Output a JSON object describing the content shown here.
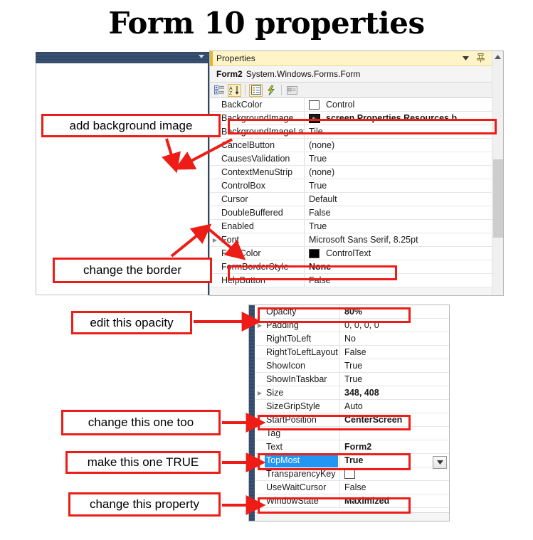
{
  "page": {
    "title": "Form 10 properties"
  },
  "designer": {
    "name": "form-designer-panel",
    "dropdown_icon": "chevron-down-icon"
  },
  "properties_window": {
    "title": "Properties",
    "titlebar_icons": [
      "chevron-down-icon",
      "pin-icon",
      "close-icon"
    ],
    "object_name": "Form2",
    "object_type": "System.Windows.Forms.Form",
    "toolbar": {
      "categorized_label": "Categorized",
      "alphabetical_label": "A↓",
      "properties_label": "Properties",
      "events_label": "Events",
      "property_pages_label": "Property Pages"
    },
    "rows": [
      {
        "name": "BackColor",
        "value": "Control",
        "expander": false,
        "bold": false,
        "swatch": "white"
      },
      {
        "name": "BackgroundImage",
        "value": "screen.Properties.Resources.b",
        "expander": false,
        "bold": true,
        "swatch": "thumb"
      },
      {
        "name": "BackgroundImageLayout",
        "value": "Tile",
        "expander": false,
        "bold": false,
        "swatch": "none"
      },
      {
        "name": "CancelButton",
        "value": "(none)",
        "expander": false,
        "bold": false,
        "swatch": "none"
      },
      {
        "name": "CausesValidation",
        "value": "True",
        "expander": false,
        "bold": false,
        "swatch": "none"
      },
      {
        "name": "ContextMenuStrip",
        "value": "(none)",
        "expander": false,
        "bold": false,
        "swatch": "none"
      },
      {
        "name": "ControlBox",
        "value": "True",
        "expander": false,
        "bold": false,
        "swatch": "none"
      },
      {
        "name": "Cursor",
        "value": "Default",
        "expander": false,
        "bold": false,
        "swatch": "none"
      },
      {
        "name": "DoubleBuffered",
        "value": "False",
        "expander": false,
        "bold": false,
        "swatch": "none"
      },
      {
        "name": "Enabled",
        "value": "True",
        "expander": false,
        "bold": false,
        "swatch": "none"
      },
      {
        "name": "Font",
        "value": "Microsoft Sans Serif, 8.25pt",
        "expander": true,
        "bold": false,
        "swatch": "none"
      },
      {
        "name": "ForeColor",
        "value": "ControlText",
        "expander": false,
        "bold": false,
        "swatch": "black"
      },
      {
        "name": "FormBorderStyle",
        "value": "None",
        "expander": false,
        "bold": true,
        "swatch": "none"
      },
      {
        "name": "HelpButton",
        "value": "False",
        "expander": false,
        "bold": false,
        "swatch": "none"
      }
    ],
    "scrollbar": {
      "up_icon": "chevron-up-icon"
    }
  },
  "properties_window_2": {
    "rows": [
      {
        "name": "Opacity",
        "value": "80%",
        "expander": false,
        "bold": true,
        "selected": false
      },
      {
        "name": "Padding",
        "value": "0, 0, 0, 0",
        "expander": true,
        "bold": false,
        "selected": false
      },
      {
        "name": "RightToLeft",
        "value": "No",
        "expander": false,
        "bold": false,
        "selected": false
      },
      {
        "name": "RightToLeftLayout",
        "value": "False",
        "expander": false,
        "bold": false,
        "selected": false
      },
      {
        "name": "ShowIcon",
        "value": "True",
        "expander": false,
        "bold": false,
        "selected": false
      },
      {
        "name": "ShowInTaskbar",
        "value": "True",
        "expander": false,
        "bold": false,
        "selected": false
      },
      {
        "name": "Size",
        "value": "348, 408",
        "expander": true,
        "bold": true,
        "selected": false
      },
      {
        "name": "SizeGripStyle",
        "value": "Auto",
        "expander": false,
        "bold": false,
        "selected": false
      },
      {
        "name": "StartPosition",
        "value": "CenterScreen",
        "expander": false,
        "bold": true,
        "selected": false
      },
      {
        "name": "Tag",
        "value": "",
        "expander": false,
        "bold": false,
        "selected": false
      },
      {
        "name": "Text",
        "value": "Form2",
        "expander": false,
        "bold": true,
        "selected": false
      },
      {
        "name": "TopMost",
        "value": "True",
        "expander": false,
        "bold": true,
        "selected": true
      },
      {
        "name": "TransparencyKey",
        "value": "",
        "expander": false,
        "bold": false,
        "selected": false,
        "swatch": "white"
      },
      {
        "name": "UseWaitCursor",
        "value": "False",
        "expander": false,
        "bold": false,
        "selected": false
      },
      {
        "name": "WindowState",
        "value": "Maximized",
        "expander": false,
        "bold": true,
        "selected": false
      }
    ],
    "combo_icon": "chevron-down-icon"
  },
  "callouts": [
    {
      "text": "add background image"
    },
    {
      "text": "change the border"
    },
    {
      "text": "edit this opacity"
    },
    {
      "text": "change this one too"
    },
    {
      "text": "make this one TRUE"
    },
    {
      "text": "change this property"
    }
  ],
  "colors": {
    "annotation_red": "#ee1c16",
    "titlebar_cream": "#fff4c8",
    "gold_accent": "#e0b73a",
    "selection_blue": "#2196f3",
    "panel_navy": "#2e4668"
  }
}
